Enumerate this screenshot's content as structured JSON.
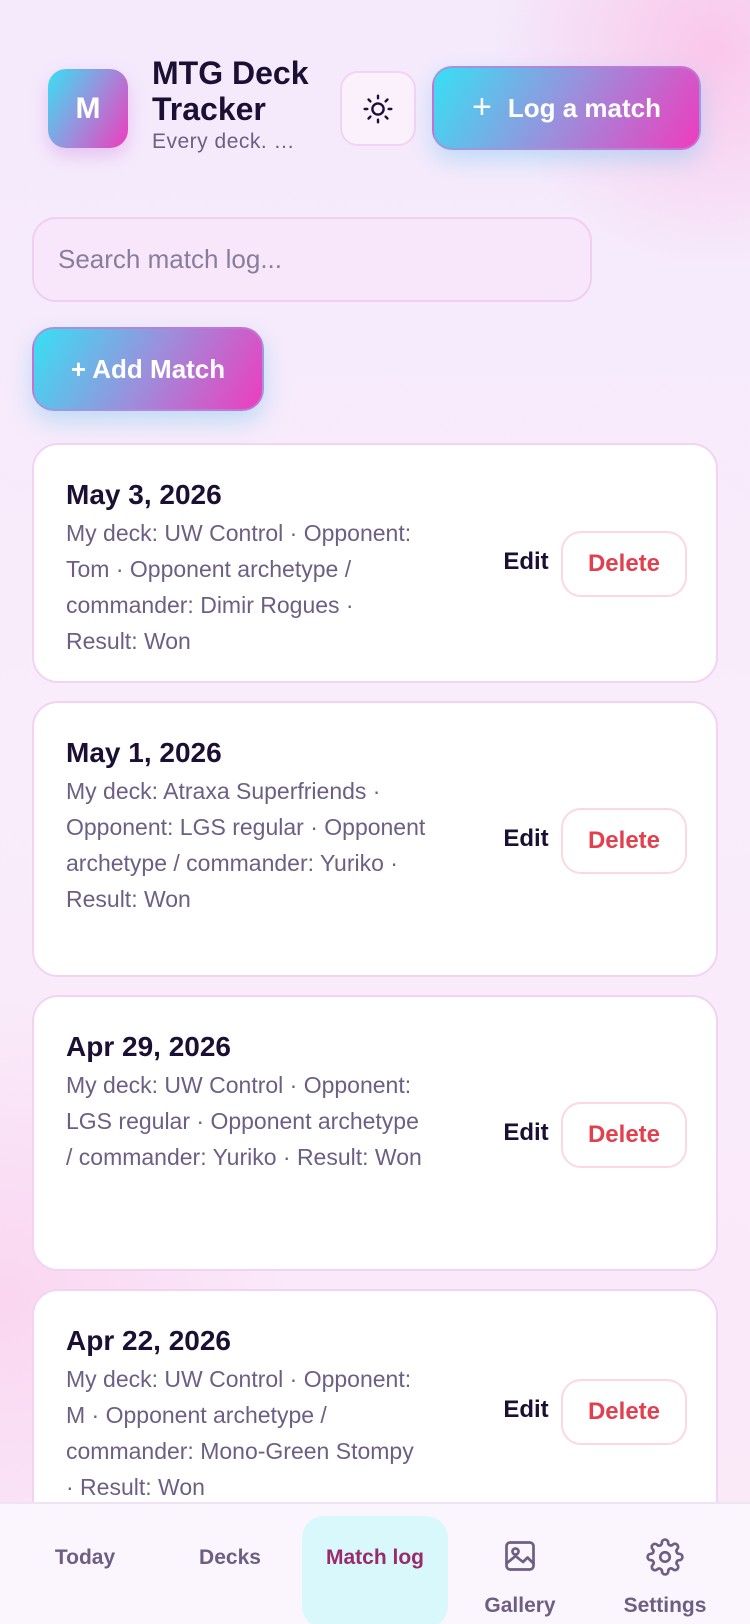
{
  "header": {
    "logo_letter": "M",
    "title": "MTG Deck Tracker",
    "tagline": "Every deck. …",
    "theme_icon": "sun-icon",
    "log_match_label": "Log a match"
  },
  "search": {
    "placeholder": "Search match log..."
  },
  "add_match_label": "+ Add Match",
  "matches": [
    {
      "date": "May 3, 2026",
      "summary": "My deck: UW Control · Opponent: Tom · Opponent archetype / commander: Dimir Rogues · Result: Won",
      "edit_label": "Edit",
      "delete_label": "Delete"
    },
    {
      "date": "May 1, 2026",
      "summary": "My deck: Atraxa Superfriends · Opponent: LGS regular · Opponent archetype / commander: Yuriko · Result: Won",
      "edit_label": "Edit",
      "delete_label": "Delete"
    },
    {
      "date": "Apr 29, 2026",
      "summary": "My deck: UW Control · Opponent: LGS regular · Opponent archetype / commander: Yuriko · Result: Won",
      "edit_label": "Edit",
      "delete_label": "Delete"
    },
    {
      "date": "Apr 22, 2026",
      "summary": "My deck: UW Control · Opponent: M · Opponent archetype / commander: Mono-Green Stompy · Result: Won",
      "edit_label": "Edit",
      "delete_label": "Delete"
    }
  ],
  "nav": {
    "today": "Today",
    "decks": "Decks",
    "match_log": "Match log",
    "gallery": "Gallery",
    "settings": "Settings",
    "active": "Match log"
  },
  "colors": {
    "accent_start": "#36e0f4",
    "accent_end": "#ee3cbd",
    "delete_red": "#e2404f"
  }
}
